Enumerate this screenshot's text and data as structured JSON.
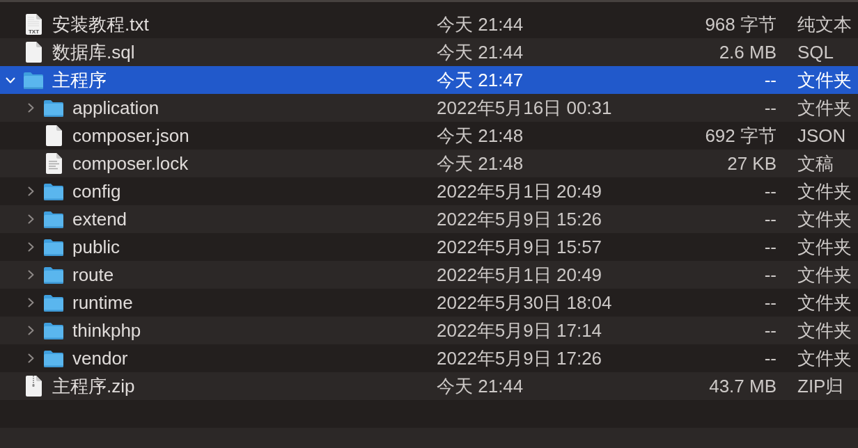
{
  "rows": [
    {
      "kind": "text_file",
      "icon_label": "TXT",
      "name": "安装教程.txt",
      "date": "今天 21:44",
      "size": "968 字节",
      "type": "纯文本",
      "selected": false
    },
    {
      "kind": "blank_file",
      "name": "数据库.sql",
      "date": "今天 21:44",
      "size": "2.6 MB",
      "type": "SQL",
      "selected": false
    },
    {
      "kind": "folder",
      "name": "主程序",
      "date": "今天 21:47",
      "size": "--",
      "type": "文件夹",
      "selected": true,
      "expanded": true,
      "children": [
        {
          "kind": "folder",
          "name": "application",
          "date": "2022年5月16日 00:31",
          "size": "--",
          "type": "文件夹",
          "selected": false,
          "expanded": false
        },
        {
          "kind": "blank_file",
          "name": "composer.json",
          "date": "今天 21:48",
          "size": "692 字节",
          "type": "JSON",
          "selected": false
        },
        {
          "kind": "lined_file",
          "name": "composer.lock",
          "date": "今天 21:48",
          "size": "27 KB",
          "type": "文稿",
          "selected": false
        },
        {
          "kind": "folder",
          "name": "config",
          "date": "2022年5月1日 20:49",
          "size": "--",
          "type": "文件夹",
          "selected": false,
          "expanded": false
        },
        {
          "kind": "folder",
          "name": "extend",
          "date": "2022年5月9日 15:26",
          "size": "--",
          "type": "文件夹",
          "selected": false,
          "expanded": false
        },
        {
          "kind": "folder",
          "name": "public",
          "date": "2022年5月9日 15:57",
          "size": "--",
          "type": "文件夹",
          "selected": false,
          "expanded": false
        },
        {
          "kind": "folder",
          "name": "route",
          "date": "2022年5月1日 20:49",
          "size": "--",
          "type": "文件夹",
          "selected": false,
          "expanded": false
        },
        {
          "kind": "folder",
          "name": "runtime",
          "date": "2022年5月30日 18:04",
          "size": "--",
          "type": "文件夹",
          "selected": false,
          "expanded": false
        },
        {
          "kind": "folder",
          "name": "thinkphp",
          "date": "2022年5月9日 17:14",
          "size": "--",
          "type": "文件夹",
          "selected": false,
          "expanded": false
        },
        {
          "kind": "folder",
          "name": "vendor",
          "date": "2022年5月9日 17:26",
          "size": "--",
          "type": "文件夹",
          "selected": false,
          "expanded": false
        }
      ]
    },
    {
      "kind": "archive",
      "name": "主程序.zip",
      "date": "今天 21:44",
      "size": "43.7 MB",
      "type": "ZIP归",
      "selected": false
    }
  ]
}
